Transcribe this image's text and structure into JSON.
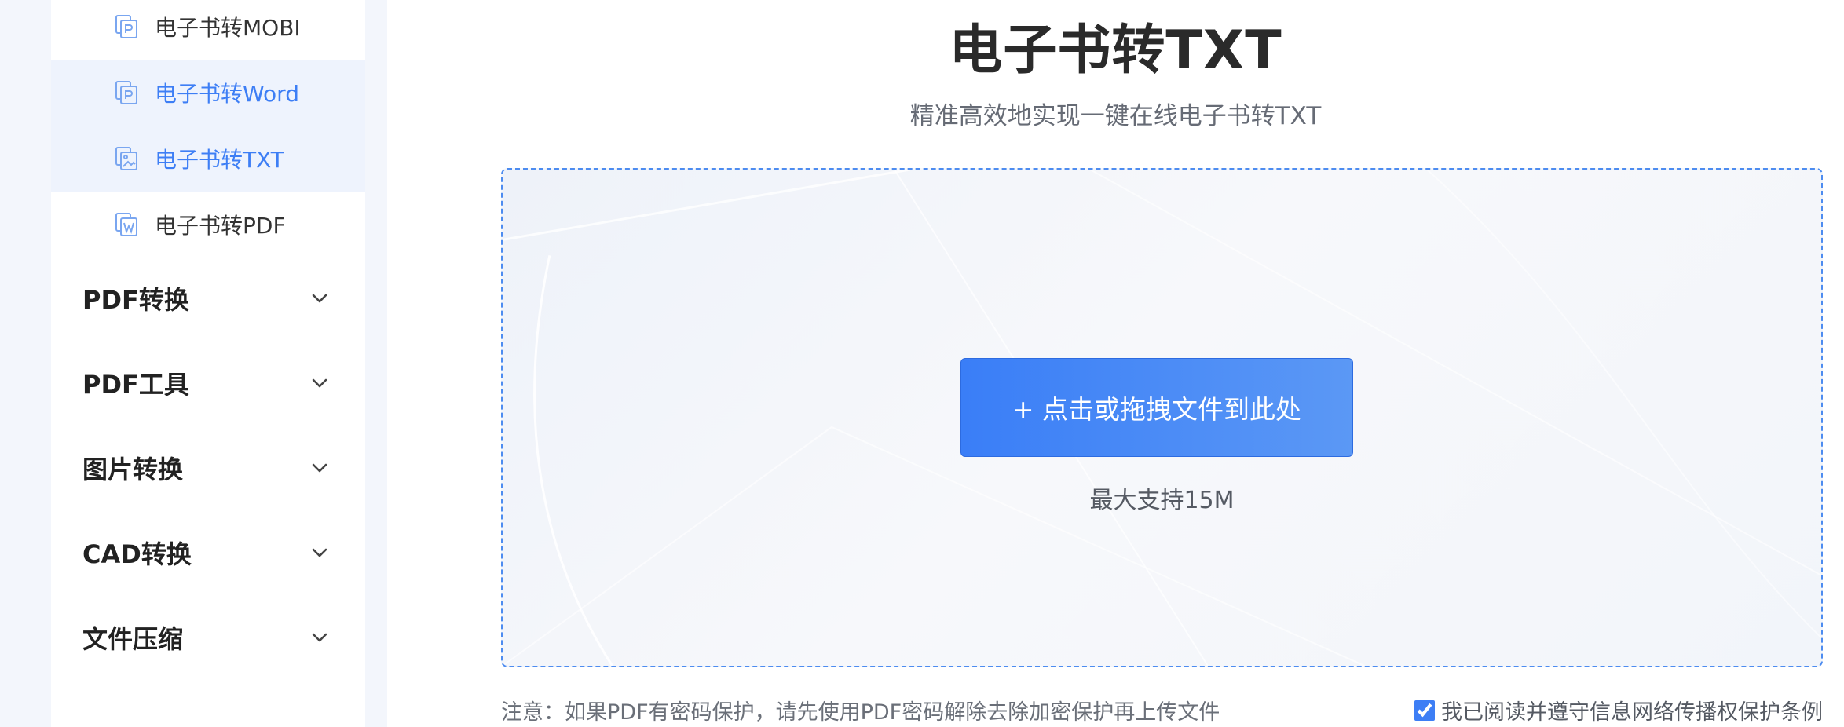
{
  "sidebar": {
    "sub_items": [
      {
        "label": "电子书转MOBI",
        "icon": "ebook-mobi-icon"
      },
      {
        "label": "电子书转Word",
        "icon": "ebook-word-icon"
      },
      {
        "label": "电子书转TXT",
        "icon": "ebook-txt-icon"
      },
      {
        "label": "电子书转PDF",
        "icon": "ebook-pdf-icon"
      }
    ],
    "categories": [
      {
        "label": "PDF转换"
      },
      {
        "label": "PDF工具"
      },
      {
        "label": "图片转换"
      },
      {
        "label": "CAD转换"
      },
      {
        "label": "文件压缩"
      }
    ]
  },
  "main": {
    "title": "电子书转TXT",
    "subtitle": "精准高效地实现一键在线电子书转TXT",
    "upload_button": "+ 点击或拖拽文件到此处",
    "size_limit": "最大支持15M",
    "notice": "注意：如果PDF有密码保护，请先使用PDF密码解除去除加密保护再上传文件",
    "agreement": "我已阅读并遵守信息网络传播权保护条例",
    "agreement_checked": true
  },
  "colors": {
    "accent": "#3d7ef5",
    "sidebar_highlight": "#eef3fd",
    "page_bg": "#f3f6fc"
  }
}
